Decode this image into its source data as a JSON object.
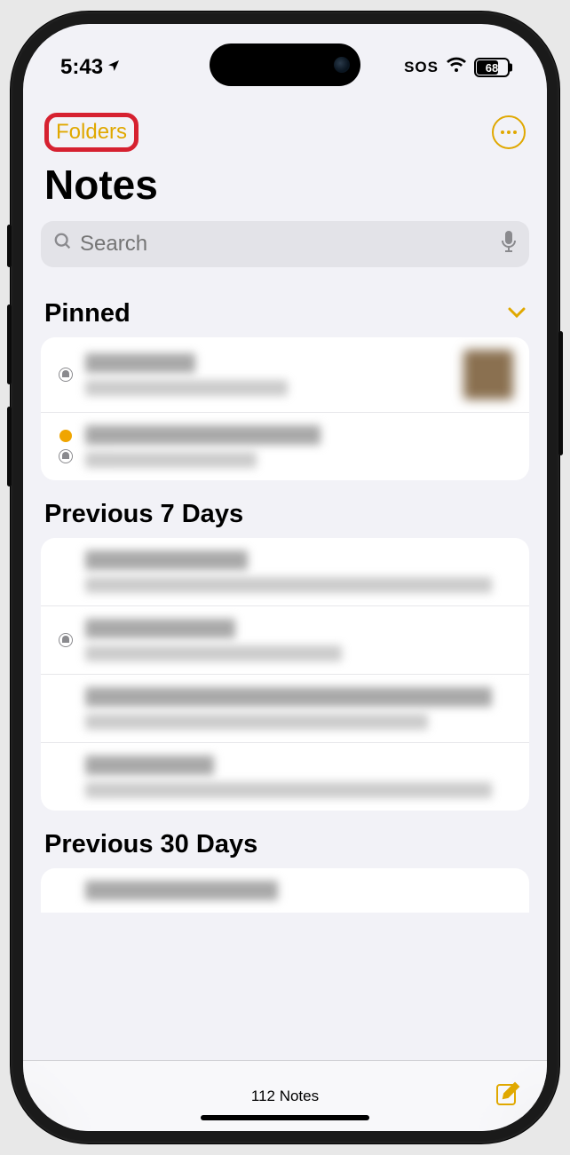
{
  "status": {
    "time": "5:43",
    "sos": "SOS",
    "battery": "68"
  },
  "nav": {
    "back_label": "Folders"
  },
  "page": {
    "title": "Notes"
  },
  "search": {
    "placeholder": "Search"
  },
  "sections": {
    "pinned": "Pinned",
    "prev7": "Previous 7 Days",
    "prev30": "Previous 30 Days"
  },
  "footer": {
    "count": "112 Notes"
  }
}
